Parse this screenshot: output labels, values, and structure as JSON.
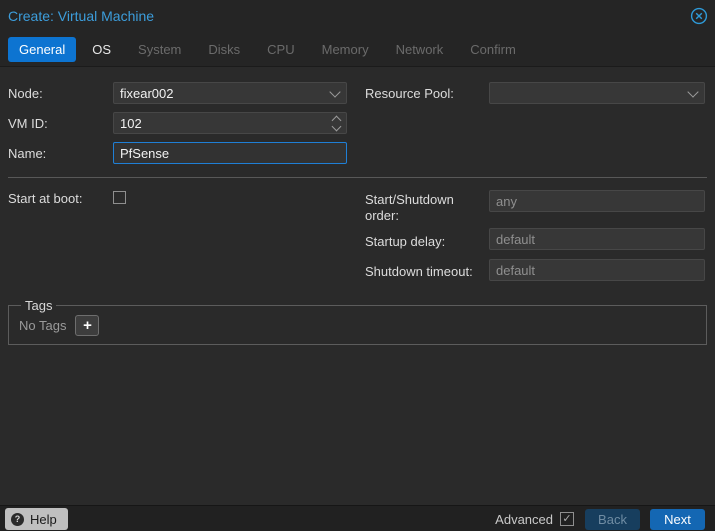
{
  "window": {
    "title": "Create: Virtual Machine"
  },
  "tabs": [
    {
      "label": "General",
      "state": "active"
    },
    {
      "label": "OS",
      "state": "enabled"
    },
    {
      "label": "System",
      "state": "disabled"
    },
    {
      "label": "Disks",
      "state": "disabled"
    },
    {
      "label": "CPU",
      "state": "disabled"
    },
    {
      "label": "Memory",
      "state": "disabled"
    },
    {
      "label": "Network",
      "state": "disabled"
    },
    {
      "label": "Confirm",
      "state": "disabled"
    }
  ],
  "form": {
    "node": {
      "label": "Node:",
      "value": "fixear002"
    },
    "vm_id": {
      "label": "VM ID:",
      "value": "102"
    },
    "name": {
      "label": "Name:",
      "value": "PfSense"
    },
    "resource_pool": {
      "label": "Resource Pool:",
      "value": ""
    },
    "start_at_boot": {
      "label": "Start at boot:",
      "checked": false
    },
    "startup_order": {
      "label": "Start/Shutdown order:",
      "value": "",
      "placeholder": "any"
    },
    "startup_delay": {
      "label": "Startup delay:",
      "value": "",
      "placeholder": "default"
    },
    "shutdown_timeout": {
      "label": "Shutdown timeout:",
      "value": "",
      "placeholder": "default"
    }
  },
  "tags": {
    "legend": "Tags",
    "empty_text": "No Tags",
    "add_label": "+"
  },
  "footer": {
    "help_label": "Help",
    "help_icon_glyph": "?",
    "advanced_label": "Advanced",
    "advanced_checked": true,
    "back_label": "Back",
    "next_label": "Next"
  },
  "colors": {
    "title_blue": "#3c9ddb",
    "active_tab_blue": "#0d74d1",
    "focus_border_blue": "#1f7fd6",
    "next_button_blue": "#1467b3",
    "back_button_blue": "#173e5e",
    "background": "#2a2a2a"
  }
}
